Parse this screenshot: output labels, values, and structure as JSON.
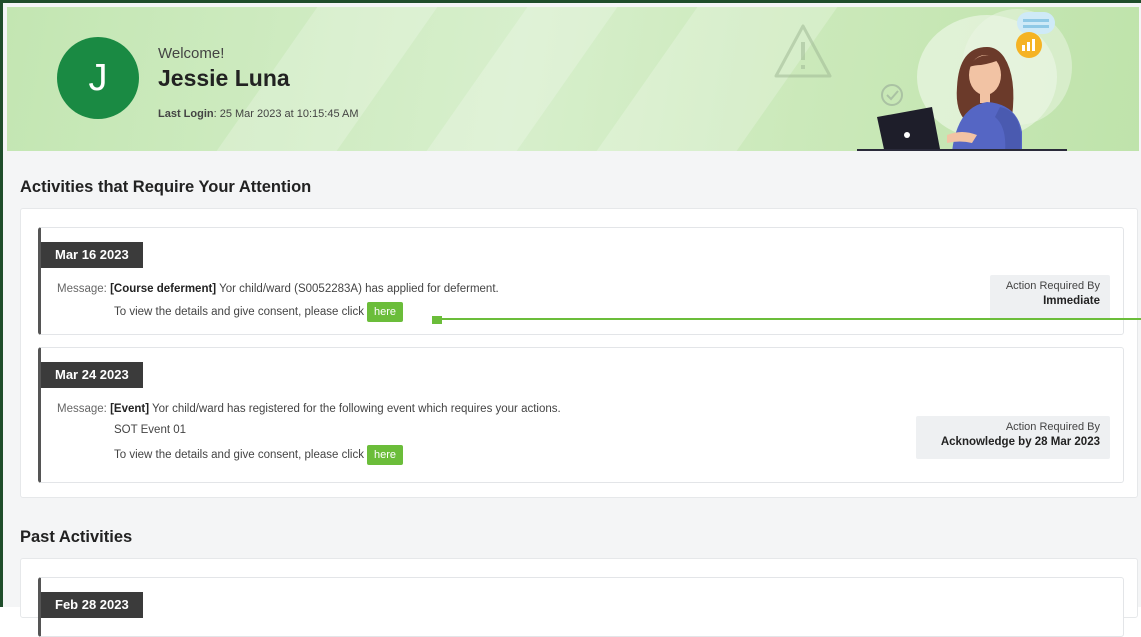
{
  "user": {
    "avatar_letter": "J",
    "welcome": "Welcome!",
    "name": "Jessie Luna",
    "last_login_label": "Last Login",
    "last_login_value": ": 25 Mar 2023 at 10:15:45 AM"
  },
  "sections": {
    "attention_title": "Activities that Require Your Attention",
    "past_title": "Past Activities"
  },
  "activities": [
    {
      "date": "Mar 16 2023",
      "message_label": "Message:",
      "message_tag": "[Course deferment]",
      "message_text": " Yor child/ward (S0052283A) has applied for deferment.",
      "consent_text": "To view the details and give consent, please click",
      "here_label": "here",
      "action_label": "Action Required By",
      "action_value": "Immediate"
    },
    {
      "date": "Mar 24 2023",
      "message_label": "Message:",
      "message_tag": "[Event]",
      "message_text": " Yor child/ward has registered for the following event which requires  your actions.",
      "event_name": "SOT Event 01",
      "consent_text": "To view the details and give consent, please click",
      "here_label": "here",
      "action_label": "Action Required By",
      "action_value": "Acknowledge by 28 Mar 2023"
    }
  ],
  "past_activities": [
    {
      "date": "Feb 28 2023"
    }
  ],
  "colors": {
    "avatar_bg": "#1a8a43",
    "here_button": "#6bbd3a",
    "date_badge": "#3b3b3b",
    "frame_border": "#1f4d2b"
  }
}
